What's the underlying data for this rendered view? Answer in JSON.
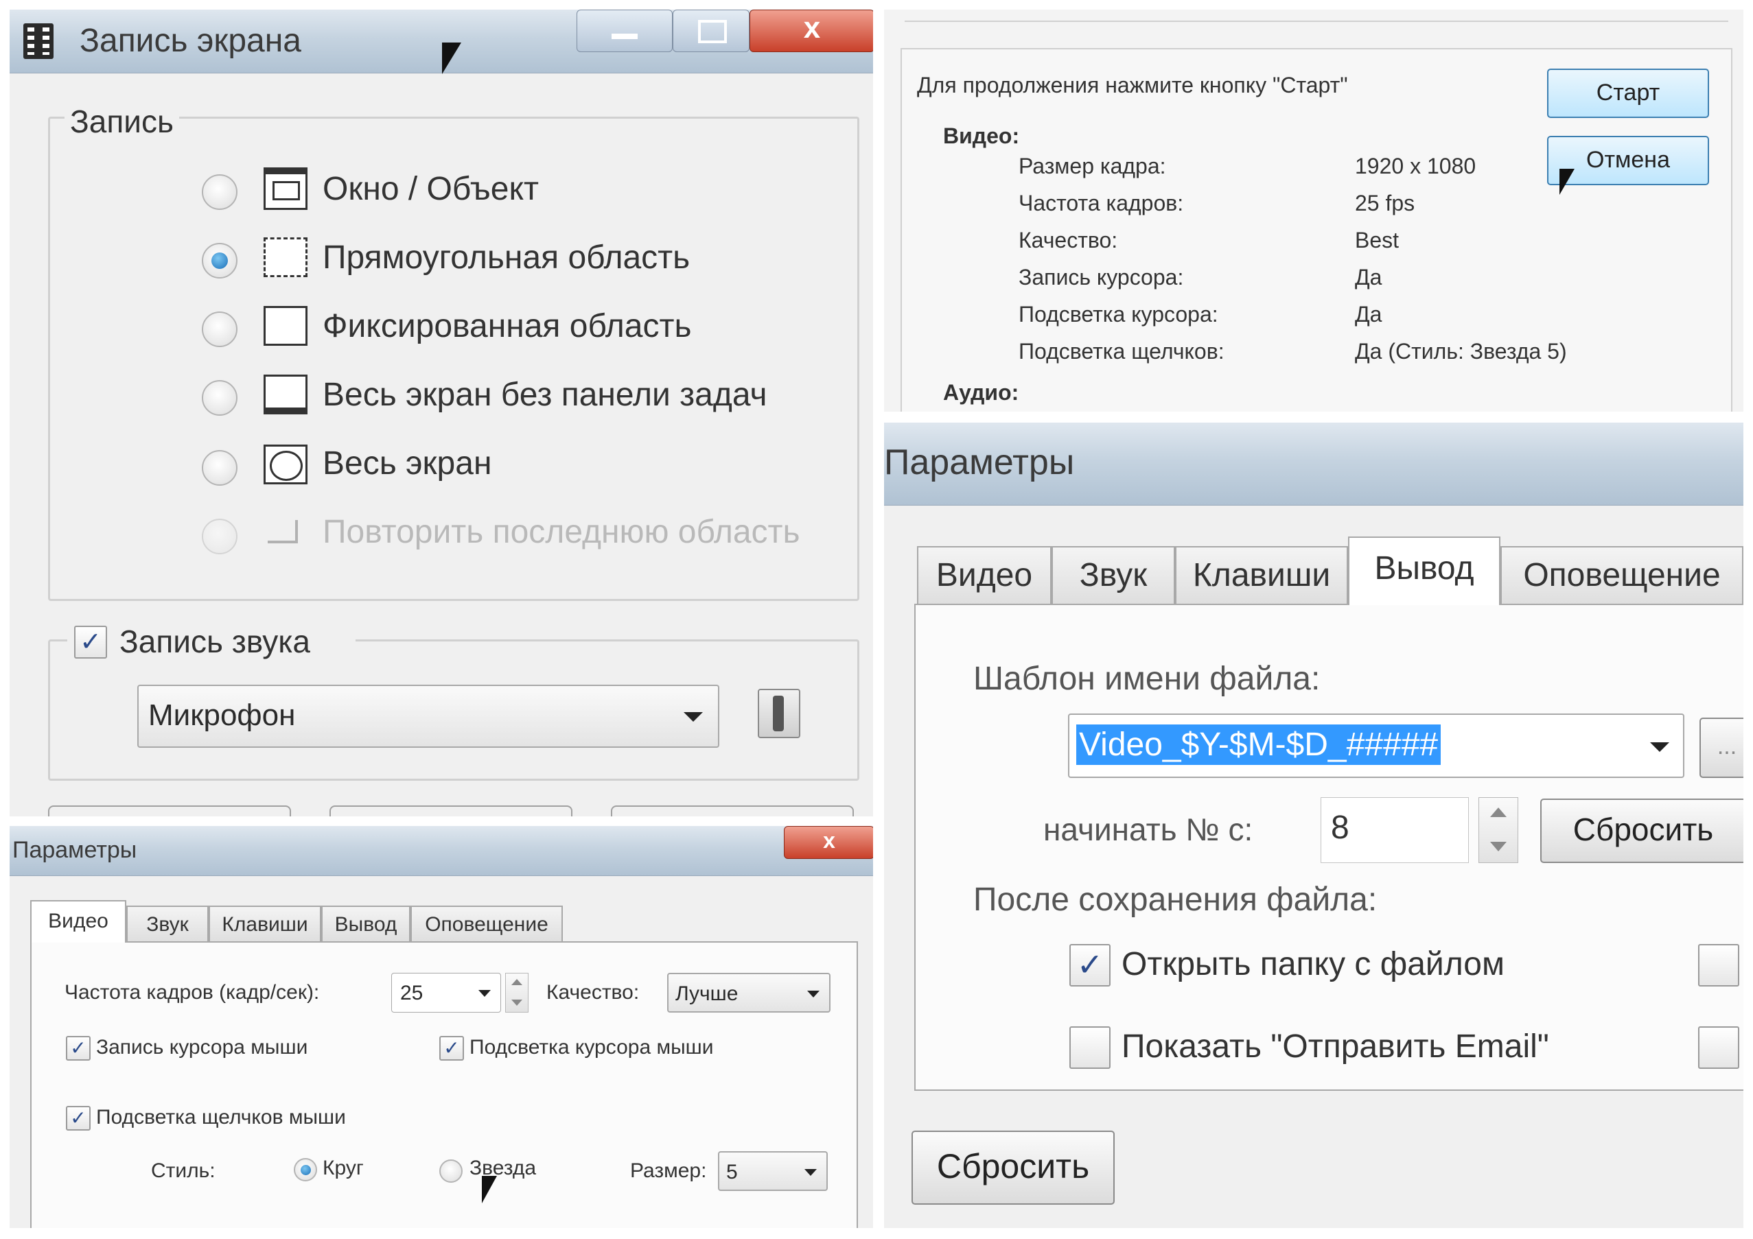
{
  "record_dialog": {
    "title": "Запись экрана",
    "close_glyph": "x",
    "group_record": "Запись",
    "options": [
      {
        "label": "Окно / Объект",
        "selected": false,
        "enabled": true,
        "icon": "window-icon"
      },
      {
        "label": "Прямоугольная область",
        "selected": true,
        "enabled": true,
        "icon": "rectangle-area-icon"
      },
      {
        "label": "Фиксированная область",
        "selected": false,
        "enabled": true,
        "icon": "fixed-area-icon"
      },
      {
        "label": "Весь экран без панели задач",
        "selected": false,
        "enabled": true,
        "icon": "screen-no-taskbar-icon"
      },
      {
        "label": "Весь экран",
        "selected": false,
        "enabled": true,
        "icon": "fullscreen-icon"
      },
      {
        "label": "Повторить последнюю область",
        "selected": false,
        "enabled": false,
        "icon": "repeat-area-icon"
      }
    ],
    "sound_checkbox_label": "Запись звука",
    "sound_checked": true,
    "check_glyph": "✓",
    "sound_source": "Микрофон"
  },
  "summary": {
    "prompt": "Для продолжения нажмите кнопку \"Старт\"",
    "start_button": "Старт",
    "cancel_button": "Отмена",
    "video_heading": "Видео:",
    "audio_heading": "Аудио:",
    "rows": [
      {
        "label": "Размер кадра:",
        "value": "1920 x 1080"
      },
      {
        "label": "Частота кадров:",
        "value": "25 fps"
      },
      {
        "label": "Качество:",
        "value": "Best"
      },
      {
        "label": "Запись курсора:",
        "value": "Да"
      },
      {
        "label": "Подсветка курсора:",
        "value": "Да"
      },
      {
        "label": "Подсветка щелчков:",
        "value": "Да (Стиль: Звезда 5)"
      }
    ]
  },
  "params_video": {
    "title": "Параметры",
    "close_glyph": "x",
    "tabs": [
      {
        "label": "Видео",
        "active": true
      },
      {
        "label": "Звук",
        "active": false
      },
      {
        "label": "Клавиши",
        "active": false
      },
      {
        "label": "Вывод",
        "active": false
      },
      {
        "label": "Оповещение",
        "active": false
      }
    ],
    "fps_label": "Частота кадров (кадр/сек):",
    "fps_value": "25",
    "quality_label": "Качество:",
    "quality_value": "Лучше",
    "cursor_record_label": "Запись курсора мыши",
    "cursor_highlight_label": "Подсветка курсора мыши",
    "click_highlight_label": "Подсветка щелчков мыши",
    "check_glyph": "✓",
    "style_label": "Стиль:",
    "style_circle": "Круг",
    "style_star": "Звезда",
    "size_label": "Размер:",
    "size_value": "5"
  },
  "params_output": {
    "title": "Параметры",
    "tabs": [
      {
        "label": "Видео",
        "active": false
      },
      {
        "label": "Звук",
        "active": false
      },
      {
        "label": "Клавиши",
        "active": false
      },
      {
        "label": "Вывод",
        "active": true
      },
      {
        "label": "Оповещение",
        "active": false
      }
    ],
    "template_label": "Шаблон имени файла:",
    "template_value": "Video_$Y-$M-$D_#####",
    "start_no_label": "начинать № с:",
    "start_no_value": "8",
    "reset_small": "Сбросить",
    "after_save_label": "После сохранения файла:",
    "open_folder_label": "Открыть папку с файлом",
    "open_folder_checked": true,
    "check_glyph": "✓",
    "show_email_label": "Показать \"Отправить Email\"",
    "show_email_checked": false,
    "reset_button": "Сбросить",
    "browse_glyph": "..."
  }
}
